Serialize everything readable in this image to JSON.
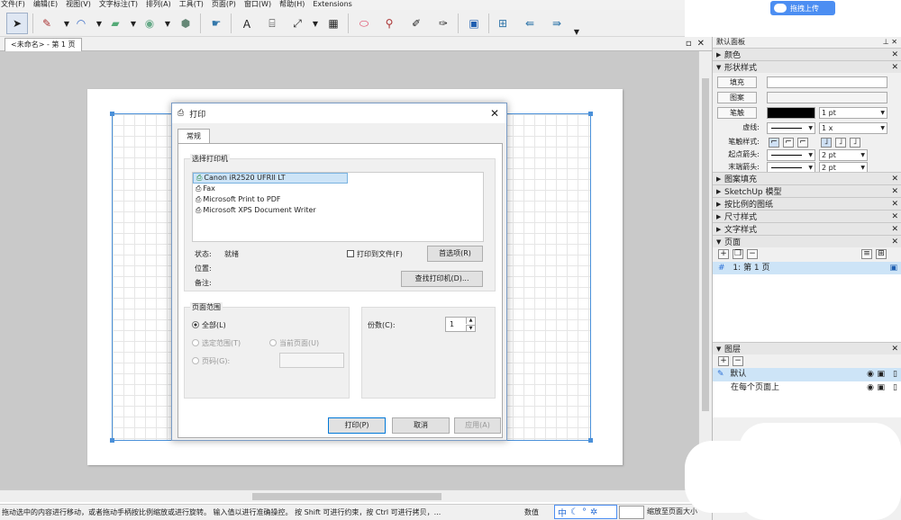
{
  "menu": [
    "文件(F)",
    "编辑(E)",
    "视图(V)",
    "文字标注(T)",
    "排列(A)",
    "工具(T)",
    "页面(P)",
    "窗口(W)",
    "帮助(H)",
    "Extensions"
  ],
  "toolbar": {
    "tools": [
      "select-icon",
      "pen-icon",
      "curve-icon",
      "rectangle-icon",
      "circle-icon",
      "polygon-icon",
      "pointer-hand-icon",
      "text-icon",
      "label-icon",
      "dimension-icon",
      "table-icon",
      "eraser-icon",
      "eyedropper-icon",
      "split-icon",
      "join-icon",
      "monitor-icon",
      "add-page-icon",
      "prev-page-icon",
      "next-page-icon"
    ]
  },
  "upload": {
    "label": "拖拽上传"
  },
  "document": {
    "tab_label": "<未命名> - 第 1 页"
  },
  "dialog": {
    "title": "打印",
    "tab": "常规",
    "select_printer_label": "选择打印机",
    "printers": [
      "Canon iR2520 UFRII LT",
      "Fax",
      "Microsoft Print to PDF",
      "Microsoft XPS Document Writer"
    ],
    "status_label": "状态:",
    "status_value": "就绪",
    "location_label": "位置:",
    "comment_label": "备注:",
    "print_to_file": "打印到文件(F)",
    "preferences": "首选项(R)",
    "find_printer": "查找打印机(D)...",
    "page_range_label": "页面范围",
    "all": "全部(L)",
    "selection": "选定范围(T)",
    "current_page": "当前页面(U)",
    "pages": "页码(G):",
    "copies_label": "份数(C):",
    "copies_value": "1",
    "print_button": "打印(P)",
    "cancel_button": "取消",
    "apply_button": "应用(A)"
  },
  "tray": {
    "title": "默认面板",
    "sections": {
      "colors": "颜色",
      "shape_style": "形状样式",
      "pattern_fill": "图案填充",
      "sketchup_model": "SketchUp 模型",
      "scaled_drawing": "按比例的图纸",
      "dimension_style": "尺寸样式",
      "text_style": "文字样式",
      "pages": "页面",
      "layers": "图层"
    },
    "shape": {
      "fill": "填充",
      "pattern": "图案",
      "stroke": "笔触",
      "stroke_width": "1 pt",
      "dash_label": "虚线:",
      "dash_scale": "1 x",
      "stroke_style_label": "笔触样式:",
      "start_arrow_label": "起点箭头:",
      "start_arrow_size": "2 pt",
      "end_arrow_label": "末端箭头:",
      "end_arrow_size": "2 pt"
    },
    "pages_list": [
      {
        "num": "1:",
        "name": "第 1 页"
      }
    ],
    "layers_list": [
      "默认",
      "在每个页面上"
    ]
  },
  "status": {
    "hint": "拖动选中的内容进行移动，或者拖动手柄按比例缩放或进行旋转。 输入值以进行准确操控。 按 Shift 可进行约束，按 Ctrl 可进行拷贝，...",
    "value_label": "数值",
    "zoom": "缩放至页面大小"
  },
  "ime": {
    "lang": "中"
  },
  "colors": {
    "accent": "#4a90d9",
    "upload_bg": "#4c8ef2"
  }
}
